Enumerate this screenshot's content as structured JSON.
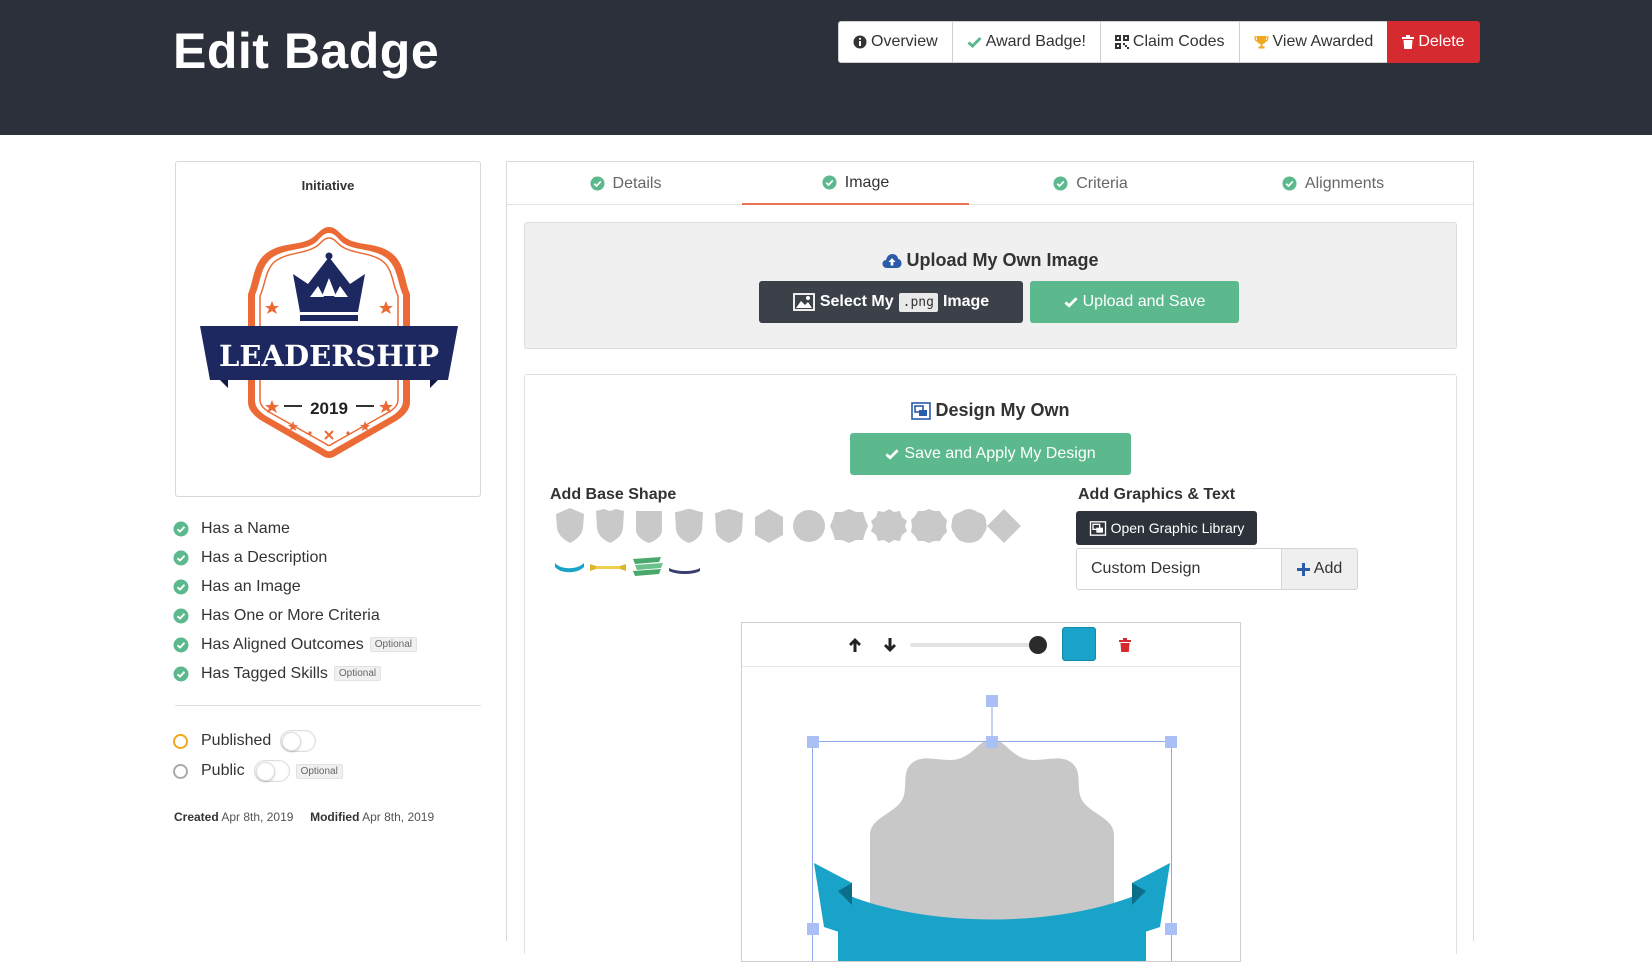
{
  "header": {
    "title": "Edit Badge",
    "buttons": [
      {
        "label": "Overview",
        "icon": "info-circle-icon"
      },
      {
        "label": "Award Badge!",
        "icon": "check-icon"
      },
      {
        "label": "Claim Codes",
        "icon": "qrcode-icon"
      },
      {
        "label": "View Awarded",
        "icon": "trophy-icon"
      },
      {
        "label": "Delete",
        "icon": "trash-icon",
        "color": "#d42a30"
      }
    ]
  },
  "preview": {
    "title": "Initiative",
    "badge_text": "LEADERSHIP",
    "badge_year": "2019",
    "colors": {
      "navy": "#1d2760",
      "orange": "#ec6a35"
    }
  },
  "checklist": [
    {
      "label": "Has a Name",
      "tag": ""
    },
    {
      "label": "Has a Description",
      "tag": ""
    },
    {
      "label": "Has an Image",
      "tag": ""
    },
    {
      "label": "Has One or More Criteria",
      "tag": ""
    },
    {
      "label": "Has Aligned Outcomes",
      "tag": "Optional"
    },
    {
      "label": "Has Tagged Skills",
      "tag": "Optional"
    }
  ],
  "status": {
    "published_label": "Published",
    "public_label": "Public",
    "public_tag": "Optional",
    "created_label": "Created",
    "created_date": "Apr 8th, 2019",
    "modified_label": "Modified",
    "modified_date": "Apr 8th, 2019"
  },
  "tabs": [
    {
      "label": "Details",
      "active": false
    },
    {
      "label": "Image",
      "active": true
    },
    {
      "label": "Criteria",
      "active": false
    },
    {
      "label": "Alignments",
      "active": false
    }
  ],
  "upload": {
    "title": "Upload My Own Image",
    "select_prefix": "Select My",
    "select_code": ".png",
    "select_suffix": "Image",
    "upload_label": "Upload and Save"
  },
  "design": {
    "title": "Design My Own",
    "save_label": "Save and Apply My Design",
    "base_shape_label": "Add Base Shape",
    "graphics_label": "Add Graphics & Text",
    "library_label": "Open Graphic Library",
    "text_input_value": "Custom Design",
    "add_label": "Add",
    "fill_color": "#1aa3c8"
  },
  "colors": {
    "header_bg": "#2b303a",
    "accent_green": "#5cb98d",
    "danger": "#d42a30",
    "tab_underline": "#e97355"
  }
}
